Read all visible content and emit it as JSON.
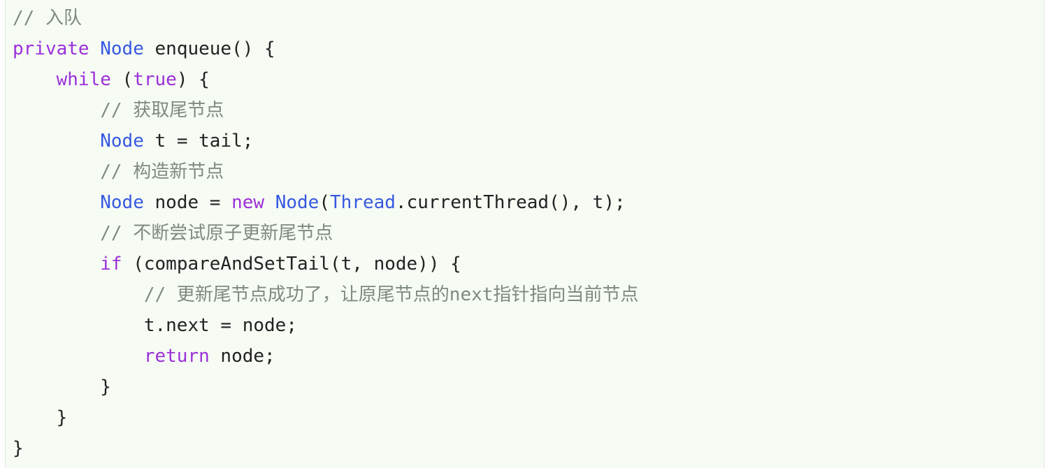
{
  "code": {
    "language": "java",
    "lines": [
      [
        {
          "t": "cm",
          "v": "// 入队"
        }
      ],
      [
        {
          "t": "kw",
          "v": "private"
        },
        {
          "t": "pl",
          "v": " "
        },
        {
          "t": "ty",
          "v": "Node"
        },
        {
          "t": "pl",
          "v": " enqueue() {"
        }
      ],
      [
        {
          "t": "pl",
          "v": "    "
        },
        {
          "t": "kw",
          "v": "while"
        },
        {
          "t": "pl",
          "v": " ("
        },
        {
          "t": "kw",
          "v": "true"
        },
        {
          "t": "pl",
          "v": ") {"
        }
      ],
      [
        {
          "t": "pl",
          "v": "        "
        },
        {
          "t": "cm",
          "v": "// 获取尾节点"
        }
      ],
      [
        {
          "t": "pl",
          "v": "        "
        },
        {
          "t": "ty",
          "v": "Node"
        },
        {
          "t": "pl",
          "v": " t = tail;"
        }
      ],
      [
        {
          "t": "pl",
          "v": "        "
        },
        {
          "t": "cm",
          "v": "// 构造新节点"
        }
      ],
      [
        {
          "t": "pl",
          "v": "        "
        },
        {
          "t": "ty",
          "v": "Node"
        },
        {
          "t": "pl",
          "v": " node = "
        },
        {
          "t": "kw",
          "v": "new"
        },
        {
          "t": "pl",
          "v": " "
        },
        {
          "t": "ty",
          "v": "Node"
        },
        {
          "t": "pl",
          "v": "("
        },
        {
          "t": "ty",
          "v": "Thread"
        },
        {
          "t": "pl",
          "v": ".currentThread(), t);"
        }
      ],
      [
        {
          "t": "pl",
          "v": "        "
        },
        {
          "t": "cm",
          "v": "// 不断尝试原子更新尾节点"
        }
      ],
      [
        {
          "t": "pl",
          "v": "        "
        },
        {
          "t": "kw",
          "v": "if"
        },
        {
          "t": "pl",
          "v": " (compareAndSetTail(t, node)) {"
        }
      ],
      [
        {
          "t": "pl",
          "v": "            "
        },
        {
          "t": "cm",
          "v": "// 更新尾节点成功了，让原尾节点的next指针指向当前节点"
        }
      ],
      [
        {
          "t": "pl",
          "v": "            t.next = node;"
        }
      ],
      [
        {
          "t": "pl",
          "v": "            "
        },
        {
          "t": "kw",
          "v": "return"
        },
        {
          "t": "pl",
          "v": " node;"
        }
      ],
      [
        {
          "t": "pl",
          "v": "        }"
        }
      ],
      [
        {
          "t": "pl",
          "v": "    }"
        }
      ],
      [
        {
          "t": "pl",
          "v": "}"
        }
      ]
    ]
  },
  "colors": {
    "background": "#f6fbf4",
    "keyword": "#9b30d9",
    "type": "#3659e0",
    "comment": "#7f8a7f",
    "plain": "#222222"
  }
}
